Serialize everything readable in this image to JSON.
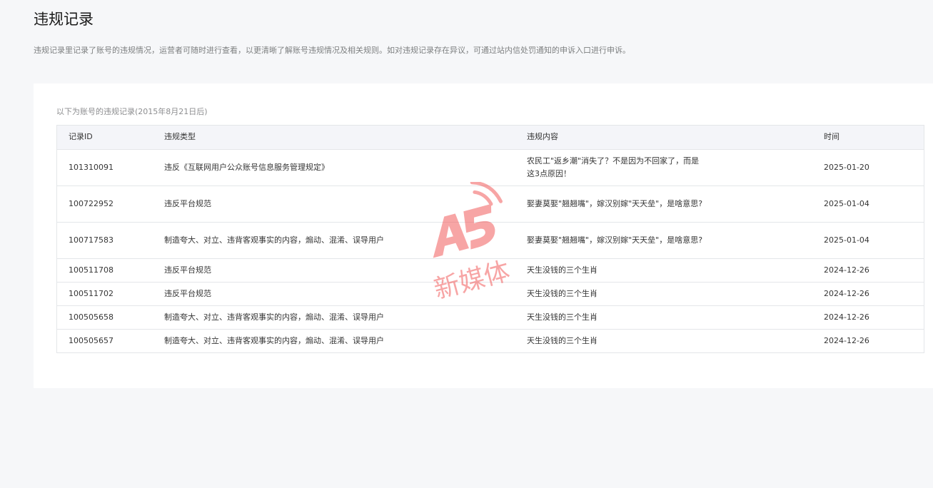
{
  "header": {
    "title": "违规记录",
    "description": "违规记录里记录了账号的违规情况，运营者可随时进行查看，以更清晰了解账号违规情况及相关规则。如对违规记录存在异议，可通过站内信处罚通知的申诉入口进行申诉。"
  },
  "table": {
    "caption": "以下为账号的违规记录(2015年8月21日后)",
    "columns": [
      "记录ID",
      "违规类型",
      "违规内容",
      "时间"
    ],
    "rows": [
      {
        "id": "101310091",
        "type": "违反《互联网用户公众账号信息服务管理规定》",
        "content": "农民工\"返乡潮\"消失了？不是因为不回家了，而是这3点原因！",
        "time": "2025-01-20"
      },
      {
        "id": "100722952",
        "type": "违反平台规范",
        "content": "娶妻莫娶\"翘翘嘴\"，嫁汉别嫁\"天天垒\"，是啥意思?",
        "time": "2025-01-04"
      },
      {
        "id": "100717583",
        "type": "制造夸大、对立、违背客观事实的内容，煽动、混淆、误导用户",
        "content": "娶妻莫娶\"翘翘嘴\"，嫁汉别嫁\"天天垒\"，是啥意思?",
        "time": "2025-01-04"
      },
      {
        "id": "100511708",
        "type": "违反平台规范",
        "content": "天生没钱的三个生肖",
        "time": "2024-12-26"
      },
      {
        "id": "100511702",
        "type": "违反平台规范",
        "content": "天生没钱的三个生肖",
        "time": "2024-12-26"
      },
      {
        "id": "100505658",
        "type": "制造夸大、对立、违背客观事实的内容，煽动、混淆、误导用户",
        "content": "天生没钱的三个生肖",
        "time": "2024-12-26"
      },
      {
        "id": "100505657",
        "type": "制造夸大、对立、违背客观事实的内容，煽动、混淆、误导用户",
        "content": "天生没钱的三个生肖",
        "time": "2024-12-26"
      }
    ]
  },
  "watermark": {
    "logo_text": "A5",
    "sub_text": "新媒体",
    "color": "#f25c5c"
  },
  "colors": {
    "background": "#f6f7f9",
    "panel": "#ffffff",
    "header_row": "#f4f5f9",
    "border": "#e4e6e9"
  }
}
